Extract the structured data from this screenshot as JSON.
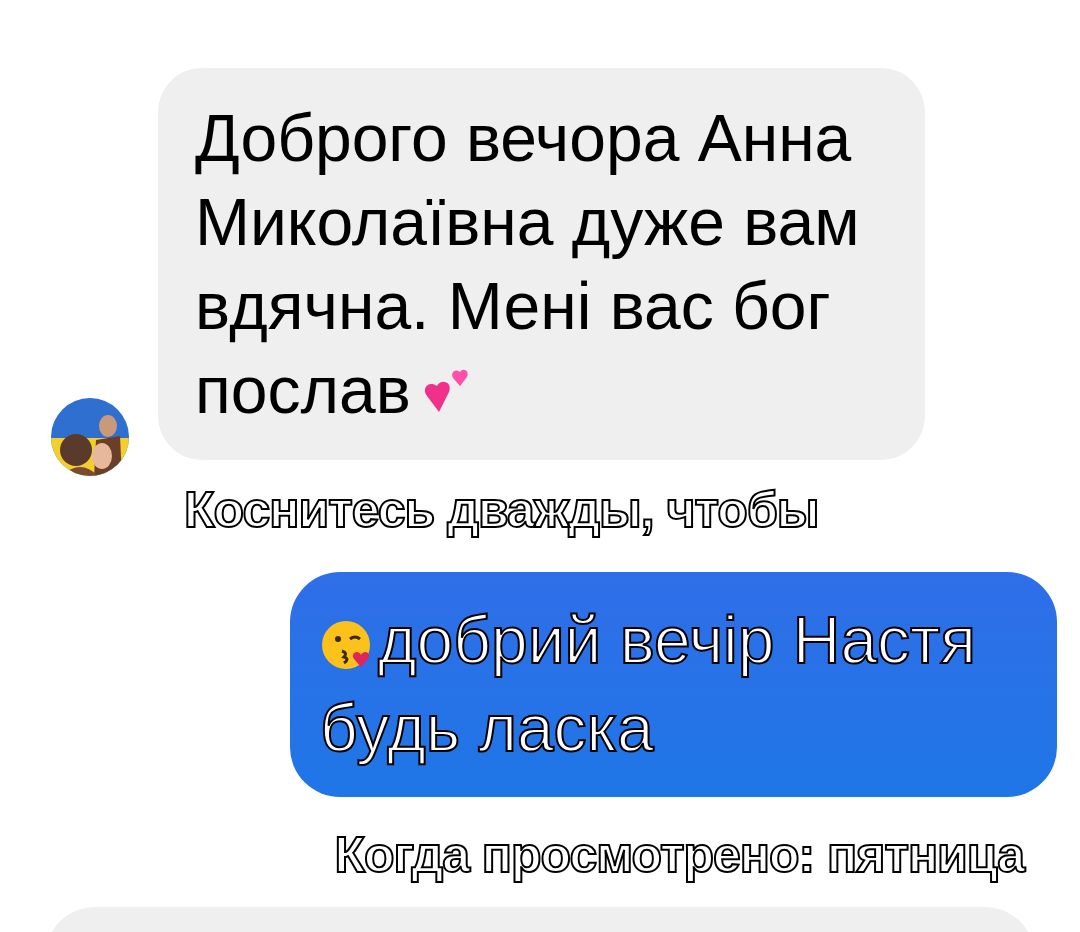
{
  "messages": [
    {
      "kind": "incoming",
      "text": "Доброго вечора Анна Миколаївна дуже вам вдячна. Мені вас бог послав"
    },
    {
      "kind": "hint",
      "text": "Коснитесь дважды, чтобы"
    },
    {
      "kind": "outgoing",
      "text": "добрий вечір Настя будь ласка"
    },
    {
      "kind": "seen",
      "text": "Когда просмотрено: пятница"
    },
    {
      "kind": "incoming_cut"
    }
  ]
}
